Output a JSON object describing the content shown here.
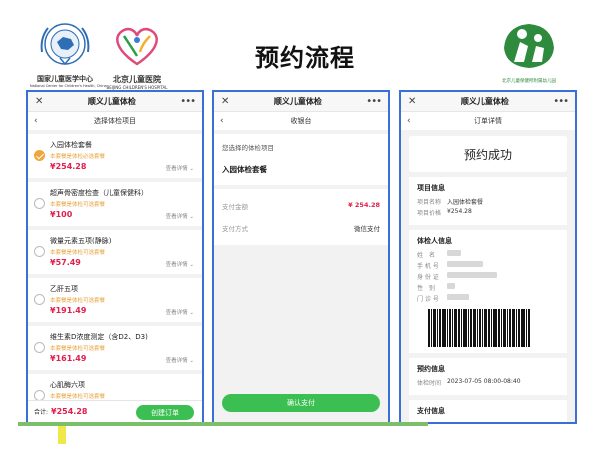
{
  "header": {
    "title": "预约流程"
  },
  "logos": {
    "left1": {
      "caption_cn": "国家儿童医学中心",
      "caption_en": "National Center for Children's Health, China"
    },
    "left2": {
      "caption_cn": "北京儿童医院",
      "caption_en": "BEIJING CHILDREN'S HOSPITAL"
    },
    "right": {
      "caption": "北京儿童保健所附属幼儿园"
    }
  },
  "phone1": {
    "topbar": {
      "close": "✕",
      "title": "顺义儿童体检",
      "more": "•••"
    },
    "subbar": {
      "back": "‹",
      "title": "选择体检项目"
    },
    "items": [
      {
        "name": "入园体检套餐",
        "note": "本套餐是体检必选套餐",
        "price": "¥254.28",
        "more": "查看详情",
        "checked": true
      },
      {
        "name": "超声骨密度检查（儿童保健科）",
        "note": "本套餐是体检可选套餐",
        "price": "¥100",
        "more": "查看详情",
        "checked": false
      },
      {
        "name": "微量元素五项(静脉)",
        "note": "本套餐是体检可选套餐",
        "price": "¥57.49",
        "more": "查看详情",
        "checked": false
      },
      {
        "name": "乙肝五项",
        "note": "本套餐是体检可选套餐",
        "price": "¥191.49",
        "more": "查看详情",
        "checked": false
      },
      {
        "name": "维生素D浓度测定（含D2、D3)",
        "note": "本套餐是体检可选套餐",
        "price": "¥161.49",
        "more": "查看详情",
        "checked": false
      },
      {
        "name": "心肌酶六项",
        "note": "本套餐是体检可选套餐",
        "price": "",
        "more": "",
        "checked": false
      }
    ],
    "footer": {
      "total_label": "合计:",
      "total": "¥254.28",
      "button": "创建订单"
    }
  },
  "phone2": {
    "topbar": {
      "close": "✕",
      "title": "顺义儿童体检",
      "more": "•••"
    },
    "subbar": {
      "back": "‹",
      "title": "收银台"
    },
    "section_label": "您选择的体检项目",
    "package": "入园体检套餐",
    "amount_label": "支付金额",
    "amount": "¥ 254.28",
    "method_label": "支付方式",
    "method": "微信支付",
    "pay_button": "确认支付"
  },
  "phone3": {
    "topbar": {
      "close": "✕",
      "title": "顺义儿童体检",
      "more": "•••"
    },
    "subbar": {
      "back": "‹",
      "title": "订单详情"
    },
    "success": "预约成功",
    "project": {
      "heading": "项目信息",
      "name_label": "项目名称",
      "name": "入园体检套餐",
      "price_label": "项目价格",
      "price": "¥254.28"
    },
    "person": {
      "heading": "体检人信息",
      "labels": [
        "姓　名",
        "手 机 号",
        "身 份 证",
        "性　别",
        "门 诊 号"
      ]
    },
    "booking": {
      "heading": "预约信息",
      "time_label": "体检时间",
      "time": "2023-07-05 08:00-08:40"
    },
    "payment": {
      "heading": "支付信息"
    }
  },
  "colors": {
    "accent_green": "#3cbf52",
    "price_red": "#e0204d",
    "note_orange": "#e8a23a",
    "frame_blue": "#3a6fd8"
  }
}
